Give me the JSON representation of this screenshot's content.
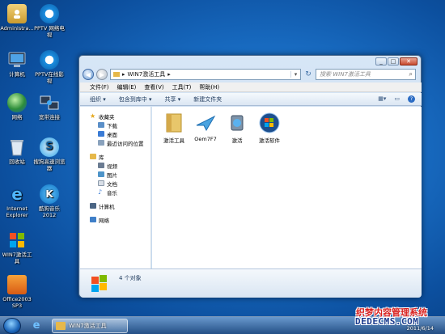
{
  "desktop": {
    "icons": [
      {
        "label": "Administra...",
        "icon": "user-folder-icon"
      },
      {
        "label": "PPTV 网络电视",
        "icon": "pptv-icon"
      },
      {
        "label": "计算机",
        "icon": "computer-icon"
      },
      {
        "label": "PPTV在线影视",
        "icon": "pptv-online-icon"
      },
      {
        "label": "网络",
        "icon": "network-icon"
      },
      {
        "label": "宽带连接",
        "icon": "broadband-icon"
      },
      {
        "label": "回收站",
        "icon": "recycle-bin-icon"
      },
      {
        "label": "搜狗高速浏览器",
        "icon": "sogou-browser-icon"
      },
      {
        "label": "Internet Explorer",
        "icon": "ie-icon"
      },
      {
        "label": "酷狗音乐2012",
        "icon": "kugou-icon"
      },
      {
        "label": "WIN7激活工具",
        "icon": "win7-activator-icon"
      },
      {
        "label": "Office2003 SP3",
        "icon": "office-icon"
      }
    ]
  },
  "explorer": {
    "address": {
      "root_arrow": "▸",
      "path": "WIN7激活工具",
      "trail_arrow": "▸"
    },
    "search_placeholder": "搜索 WIN7激活工具",
    "menu": [
      "文件(F)",
      "编辑(E)",
      "查看(V)",
      "工具(T)",
      "帮助(H)"
    ],
    "toolbar": [
      "组织 ▾",
      "包含到库中 ▾",
      "共享 ▾",
      "新建文件夹"
    ],
    "nav": {
      "favorites": {
        "label": "收藏夹",
        "items": [
          "下载",
          "桌面",
          "最近访问的位置"
        ]
      },
      "libraries": {
        "label": "库",
        "items": [
          "视频",
          "图片",
          "文档",
          "音乐"
        ]
      },
      "computer": "计算机",
      "network": "网络"
    },
    "files": [
      {
        "name": "激活工具",
        "icon": "folder-icon"
      },
      {
        "name": "Oem7F7",
        "icon": "oem-plane-icon"
      },
      {
        "name": "激活",
        "icon": "activate-tool-icon"
      },
      {
        "name": "激活软件",
        "icon": "windows-orb-icon"
      }
    ],
    "status": "4 个对象"
  },
  "taskbar": {
    "task_label": "WIN7激活工具",
    "date": "2011/6/14"
  },
  "watermark": {
    "line1": "织梦内容管理系统",
    "line2": "DEDECMS.COM"
  },
  "colors": {
    "desktop_blue": "#1a6fc6",
    "window_frame": "#c4d8ee",
    "watermark_red": "#d8211f",
    "watermark_blue": "#1c3d8f"
  }
}
